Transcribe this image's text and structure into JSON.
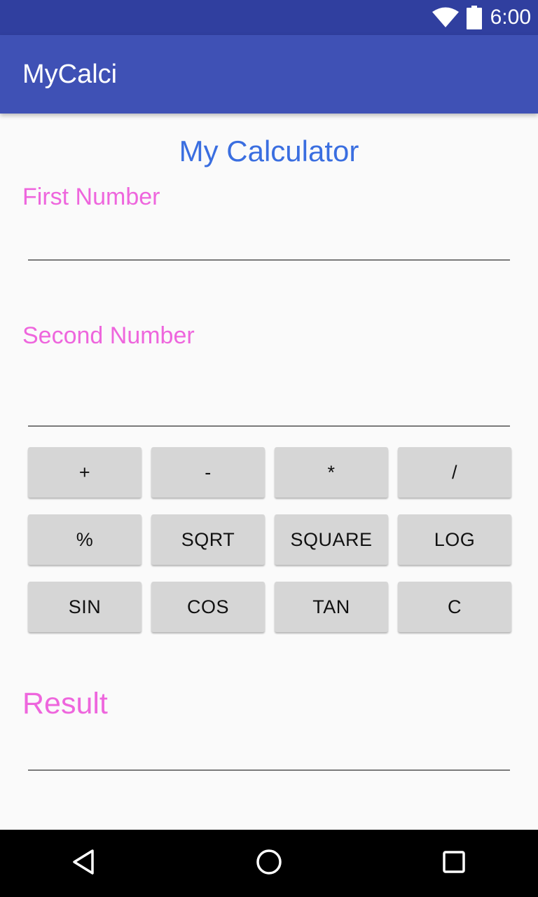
{
  "status_bar": {
    "time": "6:00",
    "icons": [
      "wifi-icon",
      "battery-icon"
    ],
    "color": "#303f9f"
  },
  "app_bar": {
    "title": "MyCalci",
    "color": "#3f51b5"
  },
  "main": {
    "heading": "My Calculator",
    "first_number": {
      "label": "First Number",
      "value": ""
    },
    "second_number": {
      "label": "Second Number",
      "value": ""
    },
    "buttons": [
      [
        "+",
        "-",
        "*",
        "/"
      ],
      [
        "%",
        "SQRT",
        "SQUARE",
        "LOG"
      ],
      [
        "SIN",
        "COS",
        "TAN",
        "C"
      ]
    ],
    "result": {
      "label": "Result",
      "value": ""
    },
    "heading_color": "#3a6ee0",
    "label_color": "#ee66dd"
  },
  "nav_bar": {
    "icons": [
      "back-icon",
      "home-icon",
      "recents-icon"
    ]
  }
}
